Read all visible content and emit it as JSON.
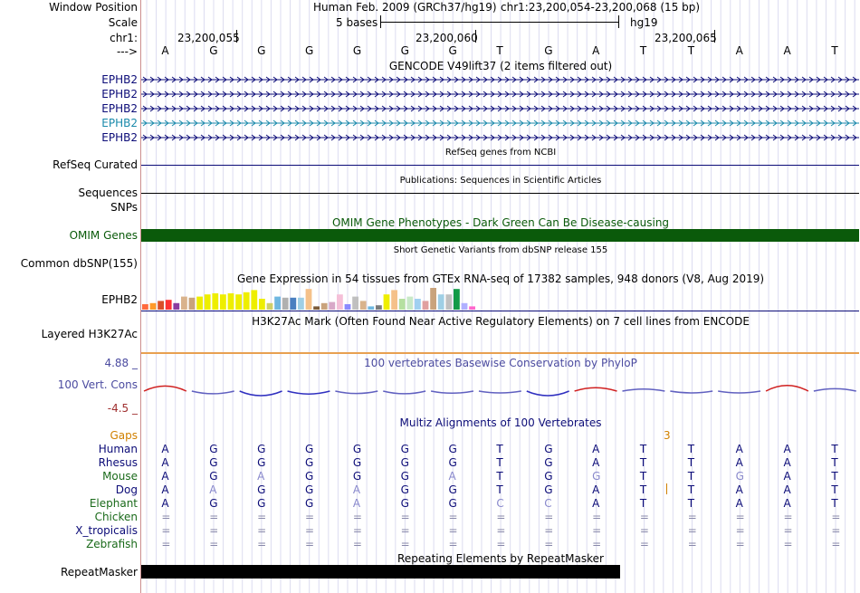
{
  "header": {
    "window_position_label": "Window Position",
    "assembly_text": "Human Feb. 2009 (GRCh37/hg19)",
    "position_text": "chr1:23,200,054-23,200,068 (15 bp)",
    "scale_label": "Scale",
    "scale_text": "5 bases",
    "scale_db": "hg19",
    "chrom_label": "chr1:",
    "ruler_positions": [
      "23,200,055",
      "23,200,060",
      "23,200,065"
    ],
    "strand_label": "--->"
  },
  "bases": [
    "A",
    "G",
    "G",
    "G",
    "G",
    "G",
    "G",
    "T",
    "G",
    "A",
    "T",
    "T",
    "A",
    "A",
    "T"
  ],
  "gencode": {
    "title": "GENCODE V49lift37 (2 items filtered out)",
    "items": [
      {
        "label": "EPHB2",
        "color": "#0c0c78"
      },
      {
        "label": "EPHB2",
        "color": "#0c0c78"
      },
      {
        "label": "EPHB2",
        "color": "#0c0c78"
      },
      {
        "label": "EPHB2",
        "color": "#1a8aab"
      },
      {
        "label": "EPHB2",
        "color": "#0c0c78"
      }
    ]
  },
  "refseq": {
    "title": "RefSeq genes from NCBI",
    "label": "RefSeq Curated",
    "color": "#0c0c78"
  },
  "publications": {
    "title": "Publications: Sequences in Scientific Articles",
    "label": "Sequences"
  },
  "snps_label": "SNPs",
  "omim": {
    "title": "OMIM Gene Phenotypes - Dark Green Can Be Disease-causing",
    "label": "OMIM Genes",
    "color": "#0a5a0a"
  },
  "dbsnp": {
    "title": "Short Genetic Variants from dbSNP release 155",
    "label": "Common dbSNP(155)"
  },
  "gtex": {
    "title": "Gene Expression in 54 tissues from GTEx RNA-seq of 17382 samples, 948 donors (V8, Aug 2019)",
    "label": "EPHB2",
    "bars": [
      {
        "v": 0.25,
        "c": "#ff6a3d"
      },
      {
        "v": 0.3,
        "c": "#ff9a2a"
      },
      {
        "v": 0.4,
        "c": "#d94f2a"
      },
      {
        "v": 0.45,
        "c": "#ff3333"
      },
      {
        "v": 0.3,
        "c": "#8a3da0"
      },
      {
        "v": 0.6,
        "c": "#d9b38c"
      },
      {
        "v": 0.55,
        "c": "#c9a37c"
      },
      {
        "v": 0.6,
        "c": "#eeee00"
      },
      {
        "v": 0.7,
        "c": "#eeee00"
      },
      {
        "v": 0.75,
        "c": "#eeee00"
      },
      {
        "v": 0.7,
        "c": "#eeee00"
      },
      {
        "v": 0.75,
        "c": "#eeee00"
      },
      {
        "v": 0.7,
        "c": "#eeee00"
      },
      {
        "v": 0.8,
        "c": "#eeee00"
      },
      {
        "v": 0.9,
        "c": "#eeee00"
      },
      {
        "v": 0.5,
        "c": "#eeee00"
      },
      {
        "v": 0.3,
        "c": "#cfcf6a"
      },
      {
        "v": 0.6,
        "c": "#6fb7e0"
      },
      {
        "v": 0.55,
        "c": "#b0b0b0"
      },
      {
        "v": 0.55,
        "c": "#4a7fc0"
      },
      {
        "v": 0.55,
        "c": "#9fcfe5"
      },
      {
        "v": 0.95,
        "c": "#f5c18a"
      },
      {
        "v": 0.15,
        "c": "#7a5a3a"
      },
      {
        "v": 0.3,
        "c": "#c9a37c"
      },
      {
        "v": 0.35,
        "c": "#d8a8c8"
      },
      {
        "v": 0.7,
        "c": "#f5c0d8"
      },
      {
        "v": 0.25,
        "c": "#8a8aff"
      },
      {
        "v": 0.6,
        "c": "#c0c0c0"
      },
      {
        "v": 0.4,
        "c": "#d9b38c"
      },
      {
        "v": 0.15,
        "c": "#6fb7e0"
      },
      {
        "v": 0.2,
        "c": "#7a7a7a"
      },
      {
        "v": 0.7,
        "c": "#eeee00"
      },
      {
        "v": 0.9,
        "c": "#f5c18a"
      },
      {
        "v": 0.5,
        "c": "#b5e0a0"
      },
      {
        "v": 0.6,
        "c": "#c8e8c8"
      },
      {
        "v": 0.5,
        "c": "#a0d0f0"
      },
      {
        "v": 0.4,
        "c": "#e0a0a0"
      },
      {
        "v": 1.0,
        "c": "#c9a37c"
      },
      {
        "v": 0.7,
        "c": "#9fcfe5"
      },
      {
        "v": 0.7,
        "c": "#c0c0c0"
      },
      {
        "v": 0.95,
        "c": "#129a47"
      },
      {
        "v": 0.3,
        "c": "#b0b0ff"
      },
      {
        "v": 0.15,
        "c": "#ff66cc"
      }
    ]
  },
  "h3k27ac": {
    "title": "H3K27Ac Mark (Often Found Near Active Regulatory Elements) on 7 cell lines from ENCODE",
    "label": "Layered H3K27Ac"
  },
  "phylop": {
    "title": "100 vertebrates Basewise Conservation by PhyloP",
    "label": "100 Vert. Cons",
    "max_label": "4.88 _",
    "min_label": "-4.5 _",
    "range": [
      -4.5,
      4.88
    ],
    "values": [
      1.2,
      -0.3,
      -1.0,
      -0.4,
      -0.2,
      -0.3,
      -0.1,
      0,
      -1.0,
      0.6,
      0.1,
      0,
      0,
      1.4,
      0.2
    ]
  },
  "multiz": {
    "title": "Multiz Alignments of 100 Vertebrates",
    "gaps_label": "Gaps",
    "gap_count": "3",
    "species": [
      {
        "label": "Human",
        "color": "#0c0c78",
        "seq": [
          "A",
          "G",
          "G",
          "G",
          "G",
          "G",
          "G",
          "T",
          "G",
          "A",
          "T",
          "T",
          "A",
          "A",
          "T"
        ]
      },
      {
        "label": "Rhesus",
        "color": "#0c0c78",
        "seq": [
          "A",
          "G",
          "G",
          "G",
          "G",
          "G",
          "G",
          "T",
          "G",
          "A",
          "T",
          "T",
          "A",
          "A",
          "T"
        ]
      },
      {
        "label": "Mouse",
        "color": "#1a6a1a",
        "seq": [
          "A",
          "G",
          "A",
          "G",
          "G",
          "G",
          "A",
          "T",
          "G",
          "G",
          "T",
          "T",
          "G",
          "A",
          "T"
        ]
      },
      {
        "label": "Dog",
        "color": "#0c0c78",
        "seq": [
          "A",
          "A",
          "G",
          "G",
          "A",
          "G",
          "G",
          "T",
          "G",
          "A",
          "T",
          "T",
          "A",
          "A",
          "T"
        ]
      },
      {
        "label": "Elephant",
        "color": "#1a6a1a",
        "seq": [
          "A",
          "G",
          "G",
          "G",
          "A",
          "G",
          "G",
          "C",
          "C",
          "A",
          "T",
          "T",
          "A",
          "A",
          "T"
        ]
      },
      {
        "label": "Chicken",
        "color": "#1a6a1a",
        "seq": [
          "=",
          "=",
          "=",
          "=",
          "=",
          "=",
          "=",
          "=",
          "=",
          "=",
          "=",
          "=",
          "=",
          "=",
          "="
        ]
      },
      {
        "label": "X_tropicalis",
        "color": "#0c0c78",
        "seq": [
          "=",
          "=",
          "=",
          "=",
          "=",
          "=",
          "=",
          "=",
          "=",
          "=",
          "=",
          "=",
          "=",
          "=",
          "="
        ]
      },
      {
        "label": "Zebrafish",
        "color": "#1a6a1a",
        "seq": [
          "=",
          "=",
          "=",
          "=",
          "=",
          "=",
          "=",
          "=",
          "=",
          "=",
          "=",
          "=",
          "=",
          "=",
          "="
        ]
      }
    ]
  },
  "repeatmasker": {
    "title": "Repeating Elements by RepeatMasker",
    "label": "RepeatMasker",
    "covered_bases": 10
  }
}
